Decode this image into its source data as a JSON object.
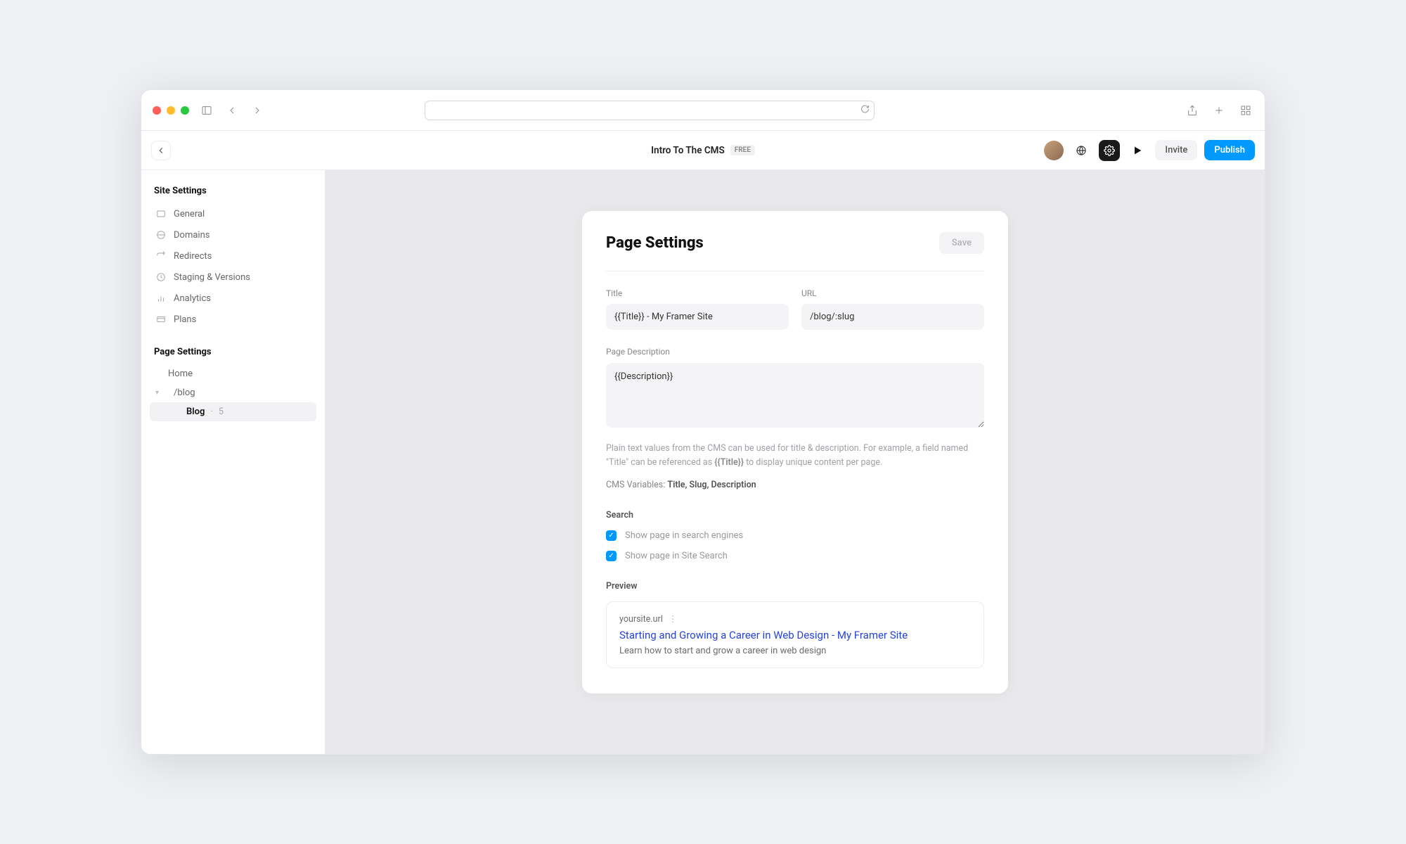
{
  "app": {
    "title": "Intro To The CMS",
    "plan_badge": "FREE",
    "invite_label": "Invite",
    "publish_label": "Publish"
  },
  "sidebar": {
    "site_settings_title": "Site Settings",
    "items": [
      {
        "label": "General"
      },
      {
        "label": "Domains"
      },
      {
        "label": "Redirects"
      },
      {
        "label": "Staging & Versions"
      },
      {
        "label": "Analytics"
      },
      {
        "label": "Plans"
      }
    ],
    "page_settings_title": "Page Settings",
    "tree": {
      "home_label": "Home",
      "blog_folder_label": "/blog",
      "blog_item_label": "Blog",
      "blog_item_count": "5"
    }
  },
  "panel": {
    "title": "Page Settings",
    "save_label": "Save",
    "fields": {
      "title_label": "Title",
      "title_value": "{{Title}} - My Framer Site",
      "url_label": "URL",
      "url_value": "/blog/:slug",
      "description_label": "Page Description",
      "description_value": "{{Description}}"
    },
    "help_text_pre": "Plain text values from the CMS can be used for title & description. For example, a field named \"Title\" can be referenced as ",
    "help_text_token": "{{Title}}",
    "help_text_post": " to display unique content per page.",
    "cms_vars_label": "CMS Variables: ",
    "cms_vars_values": "Title, Slug, Description",
    "search_heading": "Search",
    "search_checkbox1": "Show page in search engines",
    "search_checkbox2": "Show page in Site Search",
    "preview_heading": "Preview",
    "preview": {
      "url": "yoursite.url",
      "title": "Starting and Growing a Career in Web Design - My Framer Site",
      "description": "Learn how to start and grow a career in web design"
    }
  }
}
